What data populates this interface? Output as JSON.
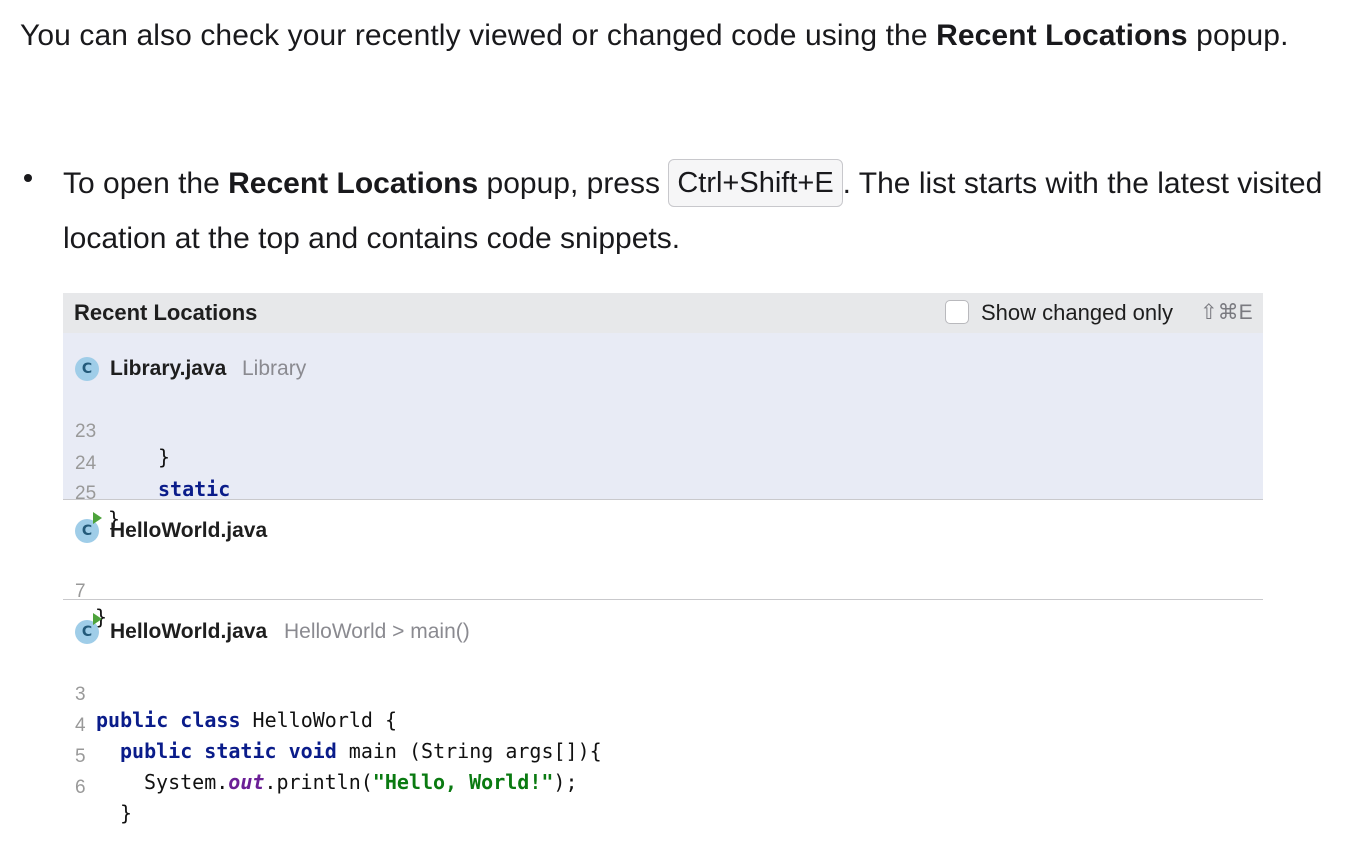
{
  "intro": {
    "text_before": "You can also check your recently viewed or changed code using the ",
    "bold": "Recent Locations",
    "text_after": " popup."
  },
  "bullet": {
    "text_before": "To open the ",
    "bold": "Recent Locations",
    "text_middle": " popup, press ",
    "shortcut": "Ctrl+Shift+E",
    "text_after": ". The list starts with the latest visited location at the top and contains code snippets."
  },
  "popup": {
    "title": "Recent Locations",
    "checkbox_label": "Show changed only",
    "checkbox_shortcut": "⇧⌘E",
    "checkbox_checked": false,
    "entries": [
      {
        "icon": "class-icon",
        "icon_letter": "C",
        "file": "Library.java",
        "context": "Library",
        "selected": true,
        "lines": [
          {
            "num": "23",
            "code": "}"
          },
          {
            "num": "24",
            "code": "static"
          },
          {
            "num": "25",
            "code": "}"
          }
        ]
      },
      {
        "icon": "runnable-class-icon",
        "icon_letter": "C",
        "file": "HelloWorld.java",
        "context": "",
        "selected": false,
        "lines": [
          {
            "num": "7",
            "code": "}"
          }
        ]
      },
      {
        "icon": "runnable-class-icon",
        "icon_letter": "C",
        "file": "HelloWorld.java",
        "context": "HelloWorld > main()",
        "selected": false,
        "lines": [
          {
            "num": "3",
            "code": "public class HelloWorld {"
          },
          {
            "num": "4",
            "code": "public static void main (String args[]){"
          },
          {
            "num": "5",
            "code": "System.out.println(\"Hello, World!\");"
          },
          {
            "num": "6",
            "code": "}"
          }
        ]
      }
    ]
  }
}
